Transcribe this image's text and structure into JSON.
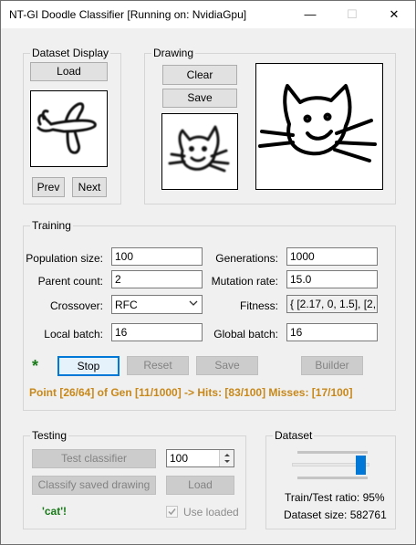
{
  "window": {
    "title": "NT-GI Doodle Classifier [Running on: NvidiaGpu]",
    "minimize_glyph": "—",
    "maximize_glyph": "☐",
    "close_glyph": "✕"
  },
  "dataset_display": {
    "legend": "Dataset Display",
    "load_label": "Load",
    "prev_label": "Prev",
    "next_label": "Next"
  },
  "drawing": {
    "legend": "Drawing",
    "clear_label": "Clear",
    "save_label": "Save"
  },
  "training": {
    "legend": "Training",
    "population_size_label": "Population size:",
    "population_size_value": "100",
    "generations_label": "Generations:",
    "generations_value": "1000",
    "parent_count_label": "Parent count:",
    "parent_count_value": "2",
    "mutation_rate_label": "Mutation rate:",
    "mutation_rate_value": "15.0",
    "crossover_label": "Crossover:",
    "crossover_value": "RFC",
    "fitness_label": "Fitness:",
    "fitness_value": "{ [2.17, 0, 1.5], [2, 0",
    "local_batch_label": "Local batch:",
    "local_batch_value": "16",
    "global_batch_label": "Global batch:",
    "global_batch_value": "16",
    "running_indicator": "*",
    "stop_label": "Stop",
    "reset_label": "Reset",
    "save_label": "Save",
    "builder_label": "Builder",
    "status": "Point [26/64] of Gen [11/1000] -> Hits: [83/100] Misses: [17/100]"
  },
  "testing": {
    "legend": "Testing",
    "test_classifier_label": "Test classifier",
    "test_count_value": "100",
    "classify_saved_label": "Classify saved drawing",
    "load_label": "Load",
    "result_text": "'cat'!",
    "use_loaded_label": "Use loaded",
    "use_loaded_checked": true
  },
  "dataset": {
    "legend": "Dataset",
    "train_test_ratio_text": "Train/Test ratio: 95%",
    "train_test_ratio_fraction": 0.95,
    "dataset_size_text": "Dataset size: 582761"
  },
  "colors": {
    "accent": "#0078d7",
    "status": "#c8881a",
    "success": "#1a7a1a"
  }
}
